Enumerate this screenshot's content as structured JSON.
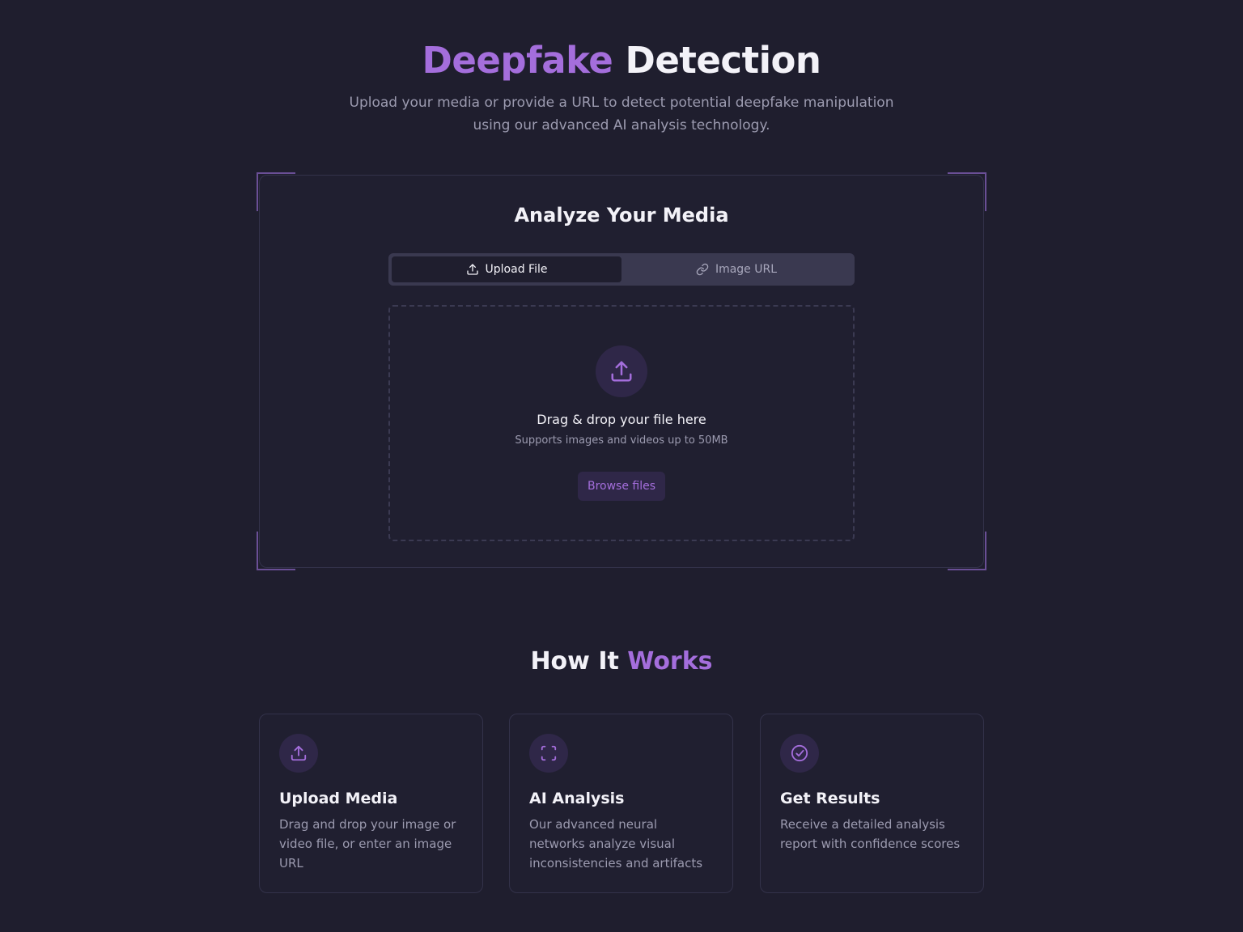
{
  "hero": {
    "title_accent": "Deepfake",
    "title_rest": "Detection",
    "subtitle": "Upload your media or provide a URL to detect potential deepfake manipulation using our advanced AI analysis technology."
  },
  "analyze": {
    "title": "Analyze Your Media",
    "tabs": [
      {
        "label": "Upload File",
        "icon": "upload-icon",
        "active": true
      },
      {
        "label": "Image URL",
        "icon": "link-icon",
        "active": false
      }
    ],
    "dropzone": {
      "icon": "upload-icon",
      "title": "Drag & drop your file here",
      "subtitle": "Supports images and videos up to 50MB",
      "button_label": "Browse files"
    }
  },
  "how": {
    "title_rest": "How It",
    "title_accent": "Works",
    "steps": [
      {
        "icon": "upload-icon",
        "title": "Upload Media",
        "description": "Drag and drop your image or video file, or enter an image URL"
      },
      {
        "icon": "scan-icon",
        "title": "AI Analysis",
        "description": "Our advanced neural networks analyze visual inconsistencies and artifacts"
      },
      {
        "icon": "check-circle-icon",
        "title": "Get Results",
        "description": "Receive a detailed analysis report with confidence scores"
      }
    ]
  },
  "colors": {
    "background": "#1f1e2e",
    "accent": "#a46edc",
    "card_border": "#33324a",
    "icon_bg": "#2f2748"
  }
}
